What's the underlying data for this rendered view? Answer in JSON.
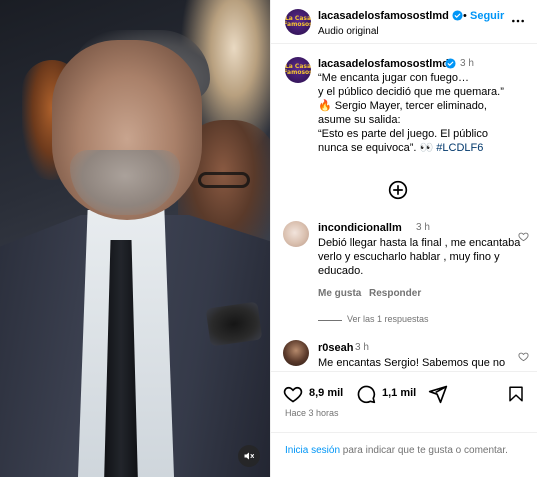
{
  "account": {
    "username": "lacasadelosfamosostlmd",
    "avatar_text": "La Casa\nFamosos",
    "follow_label": "Seguir",
    "audio_label": "Audio original",
    "separator": "•"
  },
  "caption": {
    "time": "3 h",
    "text": "“Me encanta jugar con fuego…\ny el público decidió que me quemara.”\n🔥 Sergio Mayer, tercer eliminado,\nasume su salida:\n“Esto es parte del juego. El público\nnunca se equivoca”. 👀 ",
    "hashtag": "#LCDLF6"
  },
  "comments": [
    {
      "username": "incondicionallm",
      "time": "3 h",
      "text": "Debió llegar hasta la final , me encantaba verlo y escucharlo hablar , muy fino y educado.",
      "like_label": "Me gusta",
      "reply_label": "Responder",
      "replies_label": "Ver las 1 respuestas"
    },
    {
      "username": "r0seah",
      "time": "3 h",
      "text": "Me encantas Sergio! Sabemos que no"
    }
  ],
  "actions": {
    "likes": "8,9 mil",
    "comments": "1,1 mil",
    "posted": "Hace 3 horas"
  },
  "login": {
    "link": "Inicia sesión",
    "text": " para indicar que te gusta o comentar."
  },
  "colors": {
    "accent": "#0095f6",
    "muted": "#737373",
    "hashtag": "#00376b",
    "border": "#efefef"
  },
  "icons": [
    "verified-badge-icon",
    "more-options-icon",
    "add-comment-icon",
    "heart-icon",
    "comment-icon",
    "share-icon",
    "bookmark-icon",
    "muted-speaker-icon"
  ]
}
